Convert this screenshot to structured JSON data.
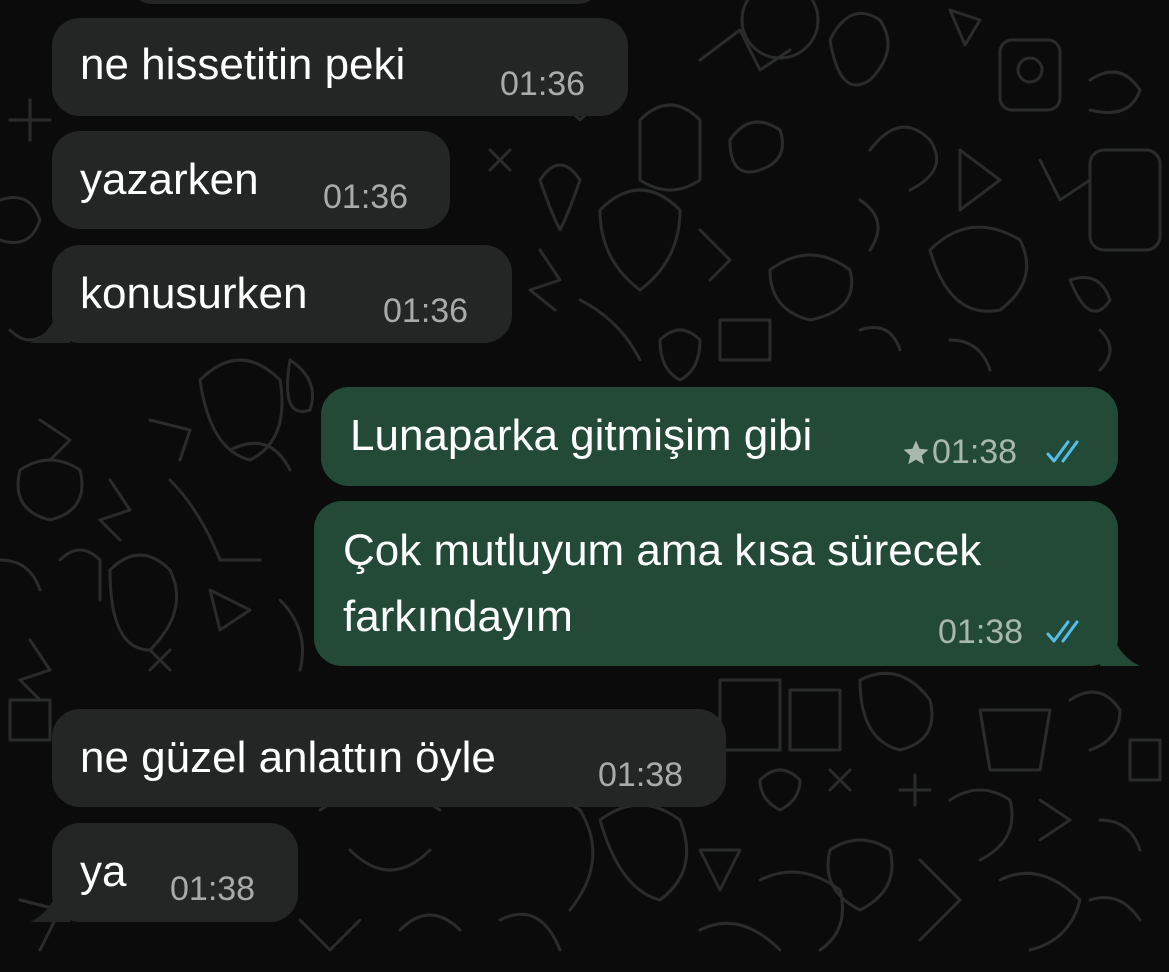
{
  "chat": {
    "messages": [
      {
        "direction": "incoming",
        "text": "ne hissetitin peki",
        "time": "01:36"
      },
      {
        "direction": "incoming",
        "text": "yazarken",
        "time": "01:36"
      },
      {
        "direction": "incoming",
        "text": "konusurken",
        "time": "01:36"
      },
      {
        "direction": "outgoing",
        "text": "Lunaparka gitmişim gibi",
        "time": "01:38",
        "starred": true,
        "status": "read"
      },
      {
        "direction": "outgoing",
        "text_lines": [
          "Çok mutluyum ama kısa sürecek",
          "farkındayım"
        ],
        "time": "01:38",
        "status": "read"
      },
      {
        "direction": "incoming",
        "text": "ne güzel anlattın öyle",
        "time": "01:38"
      },
      {
        "direction": "incoming",
        "text": "ya",
        "time": "01:38"
      }
    ]
  },
  "icons": {
    "star": "star-icon",
    "read_receipt": "double-check-icon"
  },
  "colors": {
    "background": "#0b0b0b",
    "incoming_bubble": "#242626",
    "outgoing_bubble": "#234a36",
    "read_tick": "#53bdeb",
    "timestamp": "#a8aca9"
  }
}
